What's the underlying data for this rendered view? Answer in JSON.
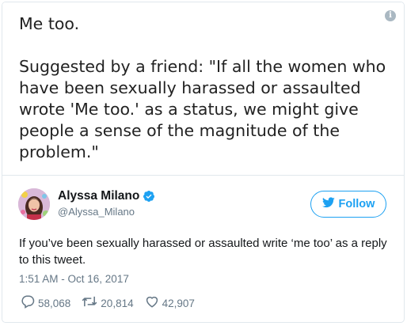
{
  "image": {
    "line1": "Me too.",
    "para_lines": [
      "Suggested by a friend: \"If all the women who",
      "have been sexually harassed or assaulted",
      "wrote 'Me too.' as a status, we might give",
      "people a sense of the magnitude of the",
      "problem.\""
    ]
  },
  "info_icon": "i",
  "author": {
    "name": "Alyssa Milano",
    "handle": "@Alyssa_Milano",
    "verified_icon": "verified-badge-icon"
  },
  "follow": {
    "label": "Follow",
    "icon": "twitter-bird-icon"
  },
  "tweet": {
    "text": "If you’ve been sexually harassed or assaulted write ‘me too’ as a reply to this tweet.",
    "timestamp": "1:51 AM - Oct 16, 2017"
  },
  "actions": {
    "replies": "58,068",
    "retweets": "20,814",
    "likes": "42,907"
  },
  "colors": {
    "accent": "#1da1f2",
    "muted": "#657786",
    "text": "#14171a"
  }
}
